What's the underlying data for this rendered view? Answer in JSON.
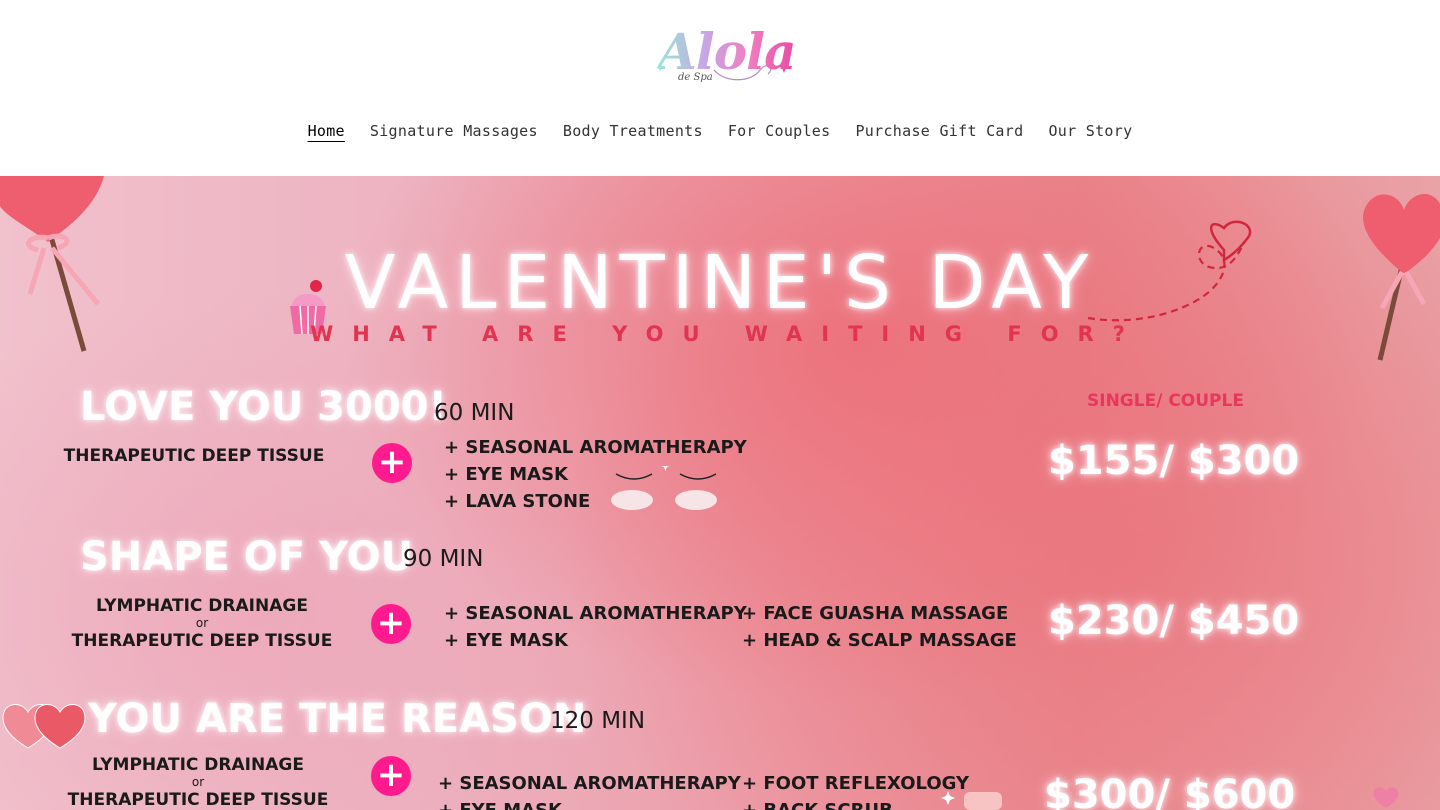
{
  "brand": {
    "logo_text": "Alola",
    "logo_sub": "de Spa"
  },
  "nav": {
    "items": [
      {
        "label": "Home",
        "active": true
      },
      {
        "label": "Signature Massages",
        "active": false
      },
      {
        "label": "Body Treatments",
        "active": false
      },
      {
        "label": "For Couples",
        "active": false
      },
      {
        "label": "Purchase Gift Card",
        "active": false
      },
      {
        "label": "Our Story",
        "active": false
      }
    ]
  },
  "banner": {
    "title": "VALENTINE'S DAY",
    "subtitle": "WHAT ARE YOU WAITING FOR?",
    "price_header": "SINGLE/ COUPLE",
    "packages": [
      {
        "name": "LOVE YOU 3000!",
        "duration": "60 MIN",
        "base": [
          "THERAPEUTIC DEEP TISSUE"
        ],
        "addons_col1": [
          "+ SEASONAL AROMATHERAPY",
          "+ EYE MASK",
          "+ LAVA STONE"
        ],
        "addons_col2": [],
        "price": "$155/ $300"
      },
      {
        "name": "SHAPE OF YOU",
        "duration": "90 MIN",
        "base": [
          "LYMPHATIC DRAINAGE",
          "or",
          "THERAPEUTIC DEEP TISSUE"
        ],
        "addons_col1": [
          "+ SEASONAL AROMATHERAPY",
          "+ EYE MASK"
        ],
        "addons_col2": [
          "+ FACE GUASHA MASSAGE",
          "+ HEAD & SCALP MASSAGE"
        ],
        "price": "$230/ $450"
      },
      {
        "name": "YOU ARE THE REASON",
        "duration": "120 MIN",
        "base": [
          "LYMPHATIC DRAINAGE",
          "or",
          "THERAPEUTIC DEEP TISSUE"
        ],
        "addons_col1": [
          "+ SEASONAL AROMATHERAPY",
          "+ EYE MASK"
        ],
        "addons_col2": [
          "+ FOOT REFLEXOLOGY",
          "+ BACK SCRUB"
        ],
        "price": "$300/ $600"
      }
    ],
    "plus_symbol": "+"
  },
  "colors": {
    "accent_pink": "#ff1b8d",
    "subtitle_red": "#e13452",
    "price_header_red": "#e8375b"
  }
}
